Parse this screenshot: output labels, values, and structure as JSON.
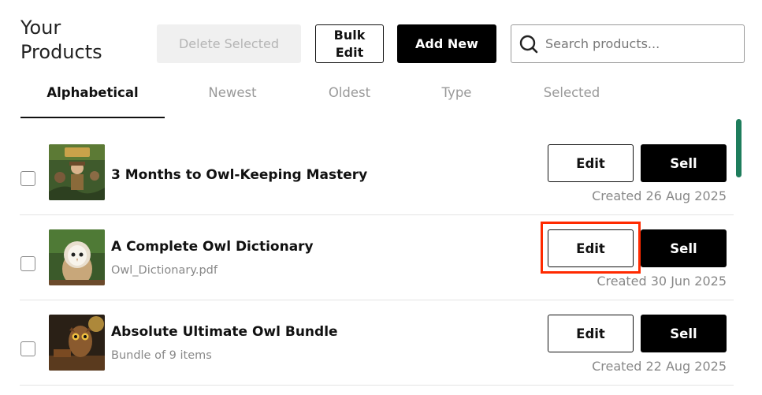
{
  "header": {
    "title": "Your Products",
    "delete_label": "Delete Selected",
    "bulk_edit_label": "Bulk Edit",
    "add_new_label": "Add New"
  },
  "search": {
    "placeholder": "Search products...",
    "value": ""
  },
  "tabs": [
    {
      "label": "Alphabetical",
      "active": true
    },
    {
      "label": "Newest",
      "active": false
    },
    {
      "label": "Oldest",
      "active": false
    },
    {
      "label": "Type",
      "active": false
    },
    {
      "label": "Selected",
      "active": false
    }
  ],
  "products": [
    {
      "title": "3 Months to Owl-Keeping Mastery",
      "subtitle": "",
      "created": "Created 26 Aug 2025",
      "edit_label": "Edit",
      "sell_label": "Sell",
      "checked": false
    },
    {
      "title": "A Complete Owl Dictionary",
      "subtitle": "Owl_Dictionary.pdf",
      "created": "Created 30 Jun 2025",
      "edit_label": "Edit",
      "sell_label": "Sell",
      "checked": false
    },
    {
      "title": "Absolute Ultimate Owl Bundle",
      "subtitle": "Bundle of 9 items",
      "created": "Created 22 Aug 2025",
      "edit_label": "Edit",
      "sell_label": "Sell",
      "checked": false
    }
  ],
  "colors": {
    "primary": "#000000",
    "highlight": "#ff2a00",
    "scrollbar": "#1e7d5c",
    "muted_text": "#888888"
  }
}
